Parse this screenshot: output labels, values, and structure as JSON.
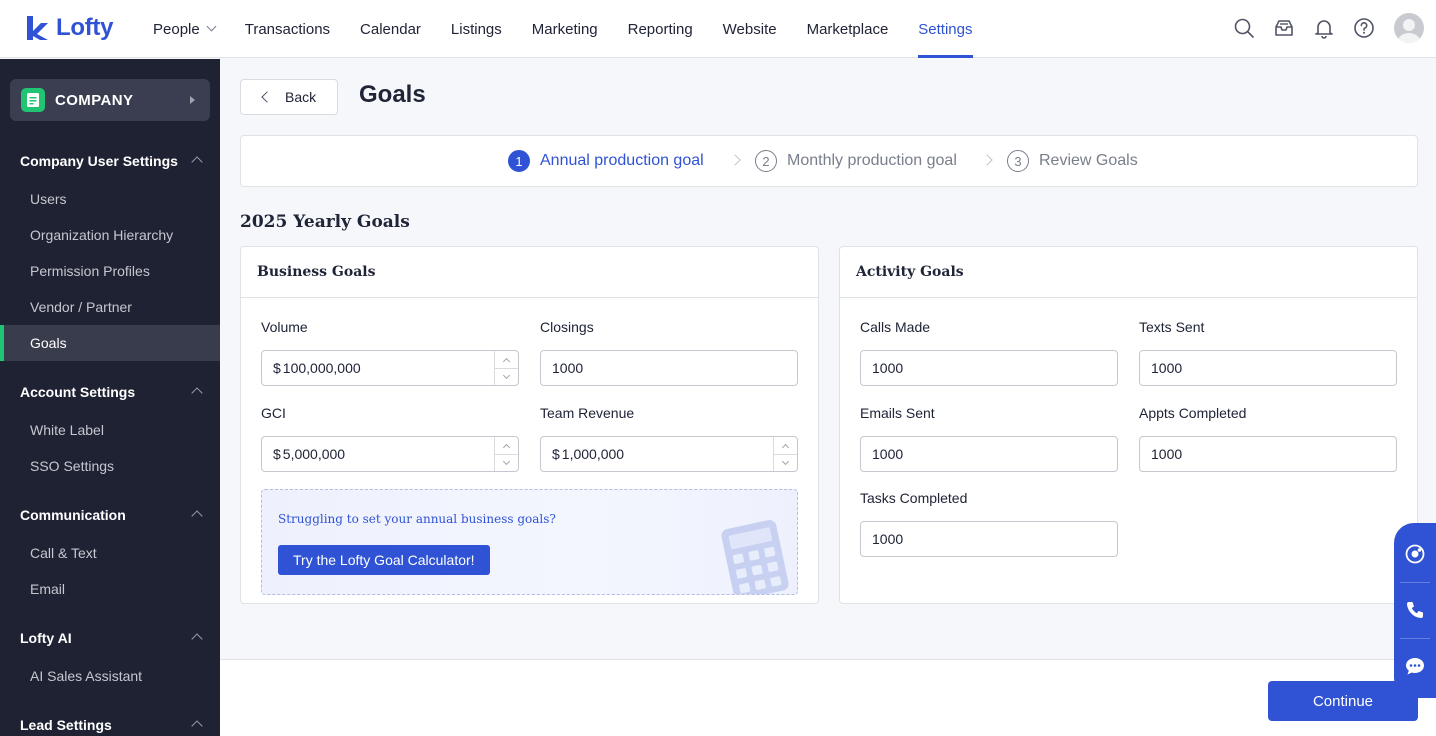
{
  "brand": {
    "name": "Lofty",
    "color": "#2f53d4"
  },
  "nav": {
    "items": [
      {
        "label": "People",
        "dropdown": true
      },
      {
        "label": "Transactions"
      },
      {
        "label": "Calendar"
      },
      {
        "label": "Listings"
      },
      {
        "label": "Marketing"
      },
      {
        "label": "Reporting"
      },
      {
        "label": "Website"
      },
      {
        "label": "Marketplace"
      },
      {
        "label": "Settings",
        "active": true
      }
    ],
    "icons": [
      "search-icon",
      "inbox-icon",
      "bell-icon",
      "help-icon",
      "avatar"
    ]
  },
  "sidebar": {
    "company_label": "COMPANY",
    "groups": [
      {
        "title": "Company User Settings",
        "items": [
          "Users",
          "Organization Hierarchy",
          "Permission Profiles",
          "Vendor / Partner",
          "Goals"
        ]
      },
      {
        "title": "Account Settings",
        "items": [
          "White Label",
          "SSO Settings"
        ]
      },
      {
        "title": "Communication",
        "items": [
          "Call & Text",
          "Email"
        ]
      },
      {
        "title": "Lofty AI",
        "items": [
          "AI Sales Assistant"
        ]
      },
      {
        "title": "Lead Settings",
        "items": []
      }
    ],
    "active_item": "Goals",
    "accent": "#20c472"
  },
  "main": {
    "back_label": "Back",
    "title": "Goals",
    "steps": [
      {
        "num": "1",
        "label": "Annual production goal",
        "active": true
      },
      {
        "num": "2",
        "label": "Monthly production goal"
      },
      {
        "num": "3",
        "label": "Review Goals"
      }
    ],
    "section_title": "2025 Yearly Goals",
    "business": {
      "title": "Business Goals",
      "volume": {
        "label": "Volume",
        "prefix": "$",
        "value": "100,000,000"
      },
      "closings": {
        "label": "Closings",
        "value": "1000"
      },
      "gci": {
        "label": "GCI",
        "prefix": "$",
        "value": "5,000,000"
      },
      "team_revenue": {
        "label": "Team Revenue",
        "prefix": "$",
        "value": "1,000,000"
      },
      "promo_text": "Struggling to set your annual business goals?",
      "promo_button": "Try the Lofty Goal Calculator!"
    },
    "activity": {
      "title": "Activity Goals",
      "calls": {
        "label": "Calls Made",
        "value": "1000"
      },
      "texts": {
        "label": "Texts Sent",
        "value": "1000"
      },
      "emails": {
        "label": "Emails Sent",
        "value": "1000"
      },
      "appts": {
        "label": "Appts Completed",
        "value": "1000"
      },
      "tasks": {
        "label": "Tasks Completed",
        "value": "1000"
      }
    }
  },
  "footer": {
    "continue_label": "Continue"
  },
  "float_widget": {
    "icons": [
      "support-icon",
      "phone-icon",
      "chat-icon"
    ]
  }
}
